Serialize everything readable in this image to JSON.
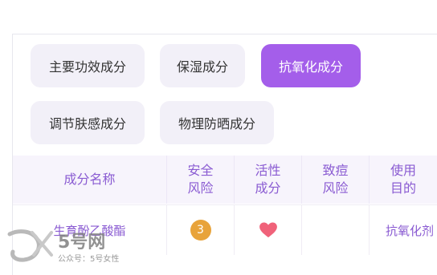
{
  "categories": [
    {
      "label": "主要功效成分",
      "active": false
    },
    {
      "label": "保湿成分",
      "active": false
    },
    {
      "label": "抗氧化成分",
      "active": true
    },
    {
      "label": "调节肤感成分",
      "active": false
    },
    {
      "label": "物理防晒成分",
      "active": false
    }
  ],
  "table": {
    "headers": [
      [
        "成分名称"
      ],
      [
        "安全",
        "风险"
      ],
      [
        "活性",
        "成分"
      ],
      [
        "致痘",
        "风险"
      ],
      [
        "使用",
        "目的"
      ]
    ],
    "rows": [
      {
        "name": "生育酚乙酸酯",
        "safety_risk": "3",
        "active_ingredient_icon": "heart-icon",
        "acne_risk": "",
        "purpose": "抗氧化剂"
      }
    ]
  },
  "watermark": {
    "brand": "5号网",
    "subtitle": "公众号：5号女性"
  },
  "colors": {
    "accent": "#a45eea",
    "chip_bg": "#f2f0f8",
    "header_text": "#8a5bd2",
    "badge": "#e8a33a",
    "heart": "#f0627a"
  }
}
